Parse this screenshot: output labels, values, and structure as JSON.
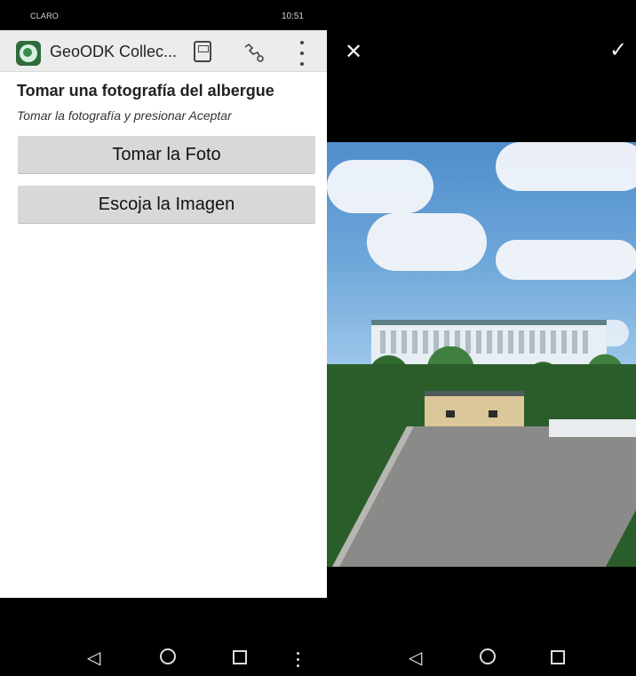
{
  "status": {
    "left_text": "CLARO",
    "time": "10:51"
  },
  "app": {
    "title": "GeoODK Collec..."
  },
  "question": {
    "title": "Tomar una fotografía del albergue",
    "hint": "Tomar la fotografía y presionar Aceptar"
  },
  "buttons": {
    "take_photo": "Tomar la Foto",
    "choose_image": "Escoja la Imagen"
  },
  "right": {
    "close": "✕",
    "confirm": "✓"
  },
  "nav": {
    "back": "◁"
  },
  "icons": {
    "app_logo": "app-logo-icon",
    "save": "save-icon",
    "path": "path-icon",
    "more": "more-icon",
    "close": "close-icon",
    "confirm": "check-icon"
  }
}
